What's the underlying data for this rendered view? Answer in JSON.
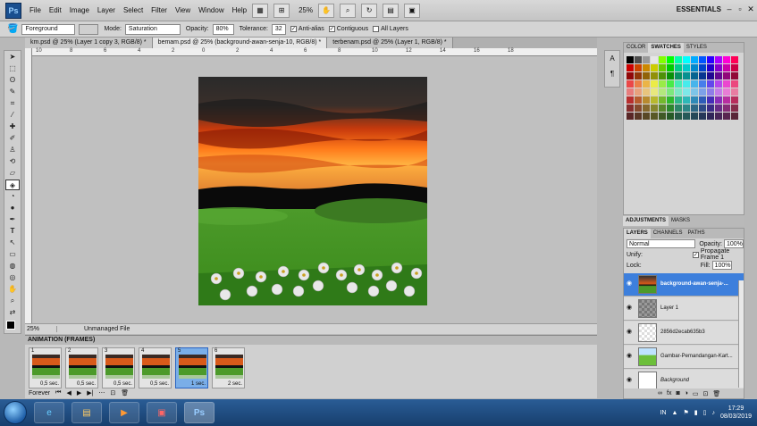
{
  "app": {
    "logo": "Ps"
  },
  "menu": [
    "File",
    "Edit",
    "Image",
    "Layer",
    "Select",
    "Filter",
    "View",
    "Window",
    "Help"
  ],
  "menubar": {
    "zoom": "25%",
    "workspace": "ESSENTIALS"
  },
  "options": {
    "preset": "Foreground",
    "mode_label": "Mode:",
    "mode_value": "Saturation",
    "opacity_label": "Opacity:",
    "opacity_value": "80%",
    "tolerance_label": "Tolerance:",
    "tolerance_value": "32",
    "antialias": "Anti-alias",
    "contiguous": "Contiguous",
    "all_layers": "All Layers"
  },
  "tabs": [
    "km.psd @ 25% (Layer 1 copy 3, RGB/8) *",
    "bemam.psd @ 25% (background-awan-senja-10, RGB/8) *",
    "terbenam.psd @ 25% (Layer 1, RGB/8) *"
  ],
  "ruler_ticks": [
    "10",
    "8",
    "6",
    "4",
    "2",
    "0",
    "2",
    "4",
    "6",
    "8",
    "10",
    "12",
    "14",
    "16",
    "18"
  ],
  "status": {
    "zoom": "25%",
    "info": "Unmanaged File"
  },
  "animation": {
    "title": "ANIMATION (FRAMES)",
    "frames": [
      {
        "num": "1",
        "delay": "0,5 sec."
      },
      {
        "num": "2",
        "delay": "0,5 sec."
      },
      {
        "num": "3",
        "delay": "0,5 sec."
      },
      {
        "num": "4",
        "delay": "0,5 sec."
      },
      {
        "num": "5",
        "delay": "1 sec."
      },
      {
        "num": "6",
        "delay": "2 sec."
      }
    ],
    "loop": "Forever"
  },
  "swatches": {
    "tabs": [
      "COLOR",
      "SWATCHES",
      "STYLES"
    ]
  },
  "adjustments": {
    "tabs": [
      "ADJUSTMENTS",
      "MASKS"
    ]
  },
  "layers": {
    "tabs": [
      "LAYERS",
      "CHANNELS",
      "PATHS"
    ],
    "blend": "Normal",
    "opacity_label": "Opacity:",
    "opacity": "100%",
    "unify": "Unify:",
    "propagate": "Propagate Frame 1",
    "lock": "Lock:",
    "fill_label": "Fill:",
    "fill": "100%",
    "items": [
      {
        "name": "background-awan-senja-...",
        "selected": true
      },
      {
        "name": "Layer 1",
        "selected": false
      },
      {
        "name": "2856d2ecab635b3",
        "selected": false
      },
      {
        "name": "Gambar-Pemandangan-Kart...",
        "selected": false
      },
      {
        "name": "Background",
        "selected": false
      }
    ]
  },
  "taskbar": {
    "lang": "IN",
    "time": "17:29",
    "date": "08/03/2019"
  }
}
